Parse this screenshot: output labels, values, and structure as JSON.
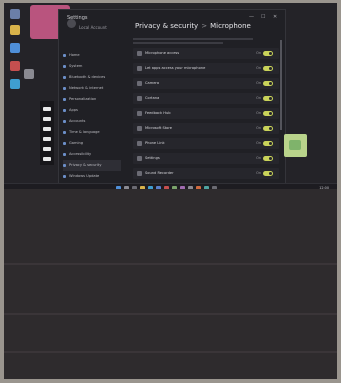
{
  "window": {
    "title": "Settings",
    "user": "Local Account",
    "breadcrumb_parent": "Privacy & security",
    "breadcrumb_sep": ">",
    "breadcrumb_current": "Microphone",
    "minimize": "—",
    "maximize": "☐",
    "close": "✕"
  },
  "nav": {
    "items": [
      {
        "label": "Home"
      },
      {
        "label": "System"
      },
      {
        "label": "Bluetooth & devices"
      },
      {
        "label": "Network & internet"
      },
      {
        "label": "Personalization"
      },
      {
        "label": "Apps"
      },
      {
        "label": "Accounts"
      },
      {
        "label": "Time & language"
      },
      {
        "label": "Gaming"
      },
      {
        "label": "Accessibility"
      },
      {
        "label": "Privacy & security"
      },
      {
        "label": "Windows Update"
      }
    ]
  },
  "main": {
    "rows": [
      {
        "label": "Microphone access",
        "state": "On"
      },
      {
        "label": "Let apps access your microphone",
        "state": "On"
      },
      {
        "label": "Camera",
        "state": "On"
      },
      {
        "label": "Cortana",
        "state": "On"
      },
      {
        "label": "Feedback Hub",
        "state": "On"
      },
      {
        "label": "Microsoft Store",
        "state": "On"
      },
      {
        "label": "Phone Link",
        "state": "On"
      },
      {
        "label": "Settings",
        "state": "On"
      },
      {
        "label": "Sound Recorder",
        "state": "On"
      },
      {
        "label": "Voice access",
        "state": "On"
      }
    ]
  },
  "taskbar": {
    "clock": "12:00"
  },
  "colors": {
    "toggle_on": "#c9d35a",
    "accent": "#6c8fc9",
    "wallpaper_accent": "#b9547e"
  }
}
